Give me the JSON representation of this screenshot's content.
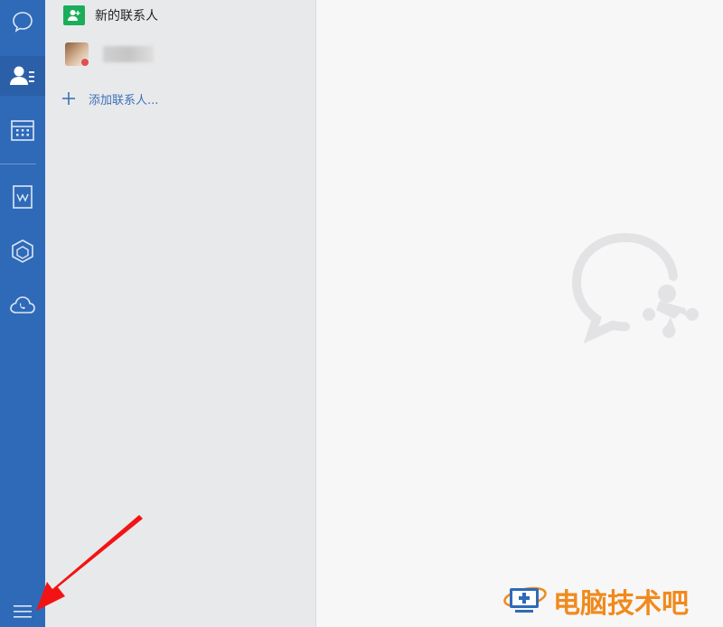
{
  "sidebar": {
    "items": [
      {
        "icon": "chat-bubble-icon"
      },
      {
        "icon": "contacts-icon"
      },
      {
        "icon": "calendar-icon"
      },
      {
        "icon": "document-icon"
      },
      {
        "icon": "box-icon"
      },
      {
        "icon": "cloud-phone-icon"
      },
      {
        "icon": "menu-icon"
      }
    ],
    "bg_color": "#2f6ab8"
  },
  "contacts": {
    "new_contact_label": "新的联系人",
    "add_contact_label": "添加联系人...",
    "accent_color": "#1aad5a",
    "link_color": "#3c72b8"
  },
  "main": {
    "logo_icon": "wecom-logo-icon"
  },
  "watermark": {
    "text": "电脑技术吧",
    "color": "#f08a1c"
  },
  "annotation": {
    "icon": "red-arrow-icon",
    "color": "#f21414"
  }
}
